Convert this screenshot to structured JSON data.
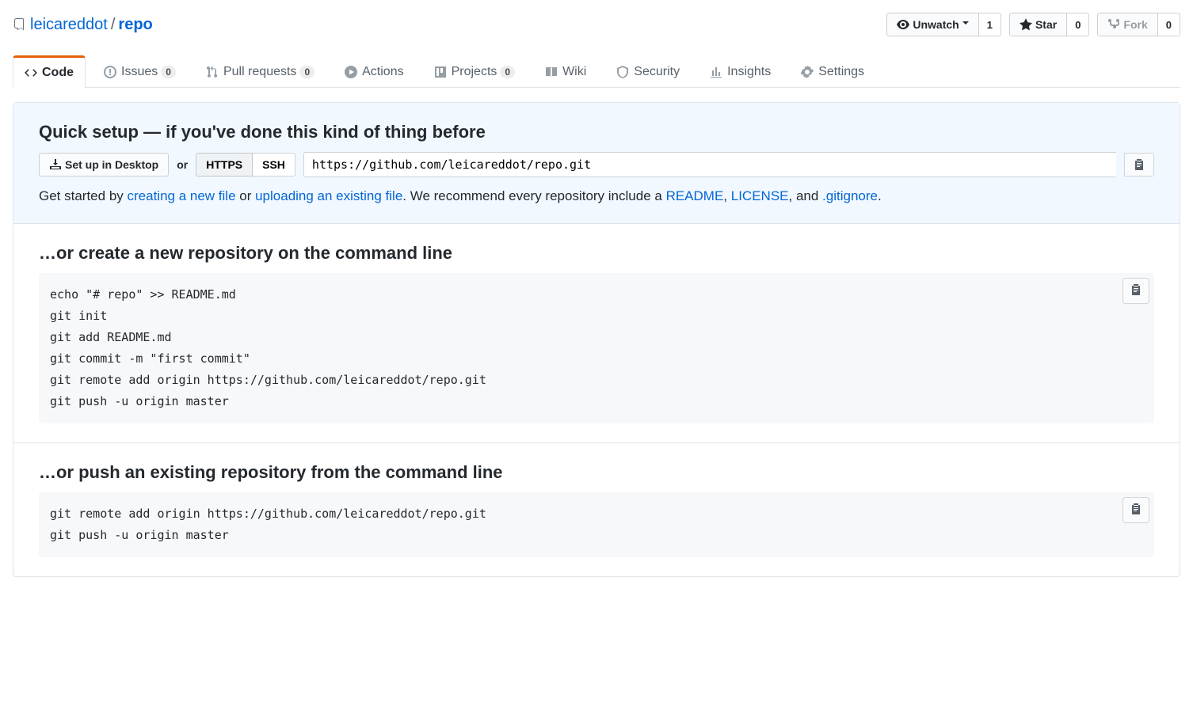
{
  "repo": {
    "owner": "leicareddot",
    "name": "repo"
  },
  "actions": {
    "unwatch": {
      "label": "Unwatch",
      "count": "1"
    },
    "star": {
      "label": "Star",
      "count": "0"
    },
    "fork": {
      "label": "Fork",
      "count": "0"
    }
  },
  "tabs": {
    "code": "Code",
    "issues": {
      "label": "Issues",
      "count": "0"
    },
    "pulls": {
      "label": "Pull requests",
      "count": "0"
    },
    "actions": "Actions",
    "projects": {
      "label": "Projects",
      "count": "0"
    },
    "wiki": "Wiki",
    "security": "Security",
    "insights": "Insights",
    "settings": "Settings"
  },
  "quick": {
    "heading": "Quick setup — if you've done this kind of thing before",
    "desktop_btn": "Set up in Desktop",
    "or": "or",
    "https": "HTTPS",
    "ssh": "SSH",
    "clone_url": "https://github.com/leicareddot/repo.git",
    "hint_pre": "Get started by ",
    "hint_new_file": "creating a new file",
    "hint_or": " or ",
    "hint_upload": "uploading an existing file",
    "hint_mid": ". We recommend every repository include a ",
    "hint_readme": "README",
    "hint_comma": ", ",
    "hint_license": "LICENSE",
    "hint_and": ", and ",
    "hint_gitignore": ".gitignore",
    "hint_end": "."
  },
  "create_section": {
    "heading": "…or create a new repository on the command line",
    "code": "echo \"# repo\" >> README.md\ngit init\ngit add README.md\ngit commit -m \"first commit\"\ngit remote add origin https://github.com/leicareddot/repo.git\ngit push -u origin master"
  },
  "push_section": {
    "heading": "…or push an existing repository from the command line",
    "code": "git remote add origin https://github.com/leicareddot/repo.git\ngit push -u origin master"
  }
}
